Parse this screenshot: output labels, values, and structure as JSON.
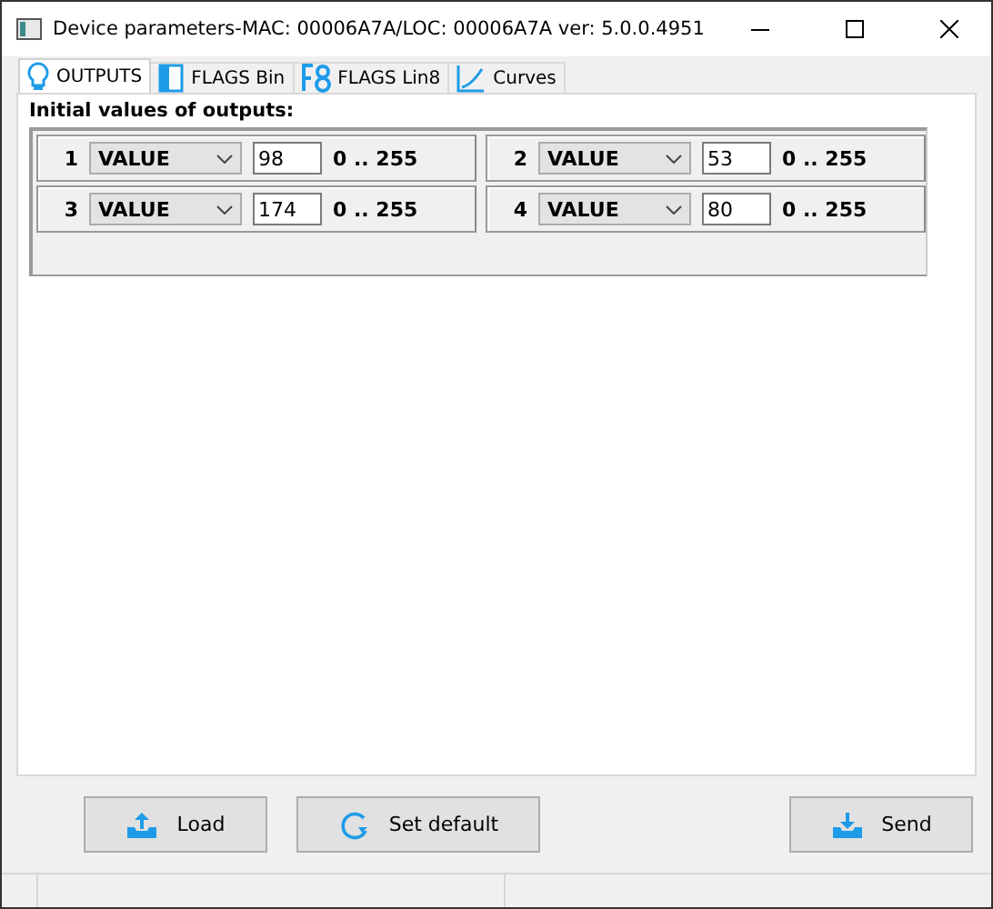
{
  "window": {
    "title": "Device parameters-MAC: 00006A7A/LOC: 00006A7A ver: 5.0.0.4951"
  },
  "tabs": [
    {
      "label": "OUTPUTS",
      "selected": true
    },
    {
      "label": "FLAGS Bin",
      "selected": false
    },
    {
      "label": "FLAGS Lin8",
      "selected": false
    },
    {
      "label": "Curves",
      "selected": false
    }
  ],
  "section_title": "Initial values of outputs:",
  "outputs": [
    {
      "number": "1",
      "mode": "VALUE",
      "value": "98",
      "range": "0 .. 255"
    },
    {
      "number": "2",
      "mode": "VALUE",
      "value": "53",
      "range": "0 .. 255"
    },
    {
      "number": "3",
      "mode": "VALUE",
      "value": "174",
      "range": "0 .. 255"
    },
    {
      "number": "4",
      "mode": "VALUE",
      "value": "80",
      "range": "0 .. 255"
    }
  ],
  "buttons": [
    {
      "label": "Load"
    },
    {
      "label": "Set default"
    },
    {
      "label": "Send"
    }
  ]
}
